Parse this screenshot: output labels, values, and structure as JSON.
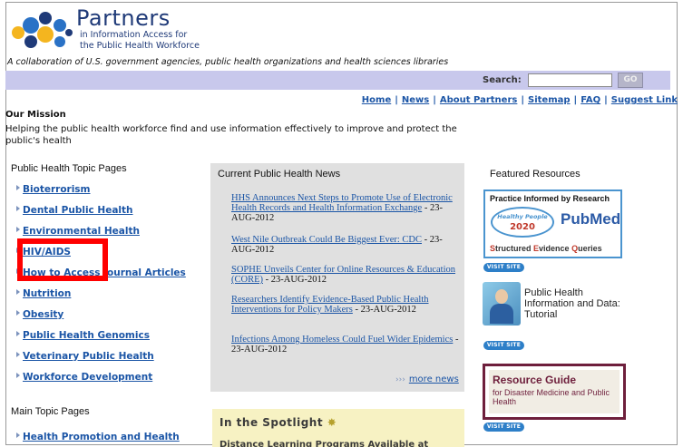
{
  "logo": {
    "title": "Partners",
    "subtitle_line1": "in Information Access for",
    "subtitle_line2": "the Public Health Workforce"
  },
  "tagline": "A collaboration of U.S. government agencies, public health organizations and health sciences libraries",
  "search": {
    "label": "Search:",
    "value": "",
    "go_label": "GO"
  },
  "topnav": [
    "Home",
    "News",
    "About Partners",
    "Sitemap",
    "FAQ",
    "Suggest Link"
  ],
  "mission": {
    "heading": "Our Mission",
    "text": "Helping the public health workforce find and use information effectively to improve and protect the public's health"
  },
  "topic_pages": {
    "heading": "Public Health Topic Pages",
    "items": [
      "Bioterrorism",
      "Dental Public Health",
      "Environmental Health",
      "HIV/AIDS",
      "How to Access Journal Articles",
      "Nutrition",
      "Obesity",
      "Public Health Genomics",
      "Veterinary Public Health",
      "Workforce Development"
    ]
  },
  "main_topic_pages": {
    "heading": "Main Topic Pages",
    "items": [
      "Health Promotion and Health"
    ]
  },
  "news": {
    "heading": "Current Public Health News",
    "items": [
      {
        "link": "HHS Announces Next Steps to Promote Use of Electronic Health Records and Health Information Exchange",
        "date": " - 23-AUG-2012"
      },
      {
        "link": "West Nile Outbreak Could Be Biggest Ever: CDC",
        "date": " - 23-AUG-2012"
      },
      {
        "link": "SOPHE Unveils Center for Online Resources & Education (CORE)",
        "date": " - 23-AUG-2012"
      },
      {
        "link": "Researchers Identify Evidence-Based Public Health Interventions for Policy Makers",
        "date": " - 23-AUG-2012"
      },
      {
        "link": "Infections Among Homeless Could Fuel Wider Epidemics",
        "date": " - 23-AUG-2012"
      }
    ],
    "more_label": "more news",
    "more_arrows": "›››"
  },
  "spotlight": {
    "heading": "In the Spotlight",
    "text": "Distance Learning Programs Available at"
  },
  "featured": {
    "heading": "Featured Resources",
    "pir": {
      "top": "Practice Informed by Research",
      "hp_text": "Healthy People",
      "hp_year": "2020",
      "pubmed": "PubMed",
      "seq_s": "S",
      "seq_1": "tructured ",
      "seq_e": "E",
      "seq_2": "vidence ",
      "seq_q": "Q",
      "seq_3": "ueries"
    },
    "visit_label": "VISIT SITE",
    "phi_text": "Public Health Information and Data: Tutorial",
    "rg_title": "Resource Guide",
    "rg_sub": "for Disaster Medicine and Public Health"
  }
}
